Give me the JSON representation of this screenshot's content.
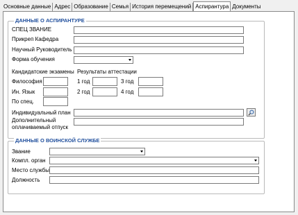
{
  "tabs": [
    {
      "label": "Основные данные",
      "active": false
    },
    {
      "label": "Адрес",
      "active": false
    },
    {
      "label": "Образование",
      "active": false
    },
    {
      "label": "Семья",
      "active": false
    },
    {
      "label": "История перемещений",
      "active": false
    },
    {
      "label": "Аспирантура",
      "active": true
    },
    {
      "label": "Документы",
      "active": false
    }
  ],
  "aspirant": {
    "title": "ДАННЫЕ О АСПИРАНТУРЕ",
    "spec_zvanie_label": "СПЕЦ ЗВАНИЕ",
    "spec_zvanie_value": "",
    "kafedra_label": "Прикреп Кафедра",
    "kafedra_value": "",
    "supervisor_label": "Научный Руководитель",
    "supervisor_value": "",
    "form_label": "Форма обучения",
    "form_value": "",
    "exams_header": "Кандидатские экзамены",
    "results_header": "Результаты аттестации",
    "philosophy_label": "Философия",
    "philosophy_value": "",
    "language_label": "Ин. Язык",
    "language_value": "",
    "special_label": "По спец.",
    "special_value": "",
    "year1_label": "1 год",
    "year1_value": "",
    "year2_label": "2 год",
    "year2_value": "",
    "year3_label": "3 год",
    "year3_value": "",
    "year4_label": "4 год",
    "year4_value": "",
    "plan_label": "Индивидуальный план",
    "plan_value": "",
    "leave_label_1": "Дополнительный",
    "leave_label_2": "оплачиваемый отпуск",
    "leave_value": ""
  },
  "military": {
    "title": "ДАННЫЕ О ВОИНСКОЙ СЛУЖБЕ",
    "rank_label": "Звание",
    "rank_value": "",
    "organ_label": "Компл. орган",
    "organ_value": "",
    "place_label": "Место службы",
    "place_value": "",
    "position_label": "Должность",
    "position_value": ""
  },
  "colors": {
    "group_title": "#1f4e9c",
    "border": "#7a7a7a"
  },
  "icons": {
    "browse": "magnifier-icon",
    "dropdown": "chevron-down-icon"
  }
}
